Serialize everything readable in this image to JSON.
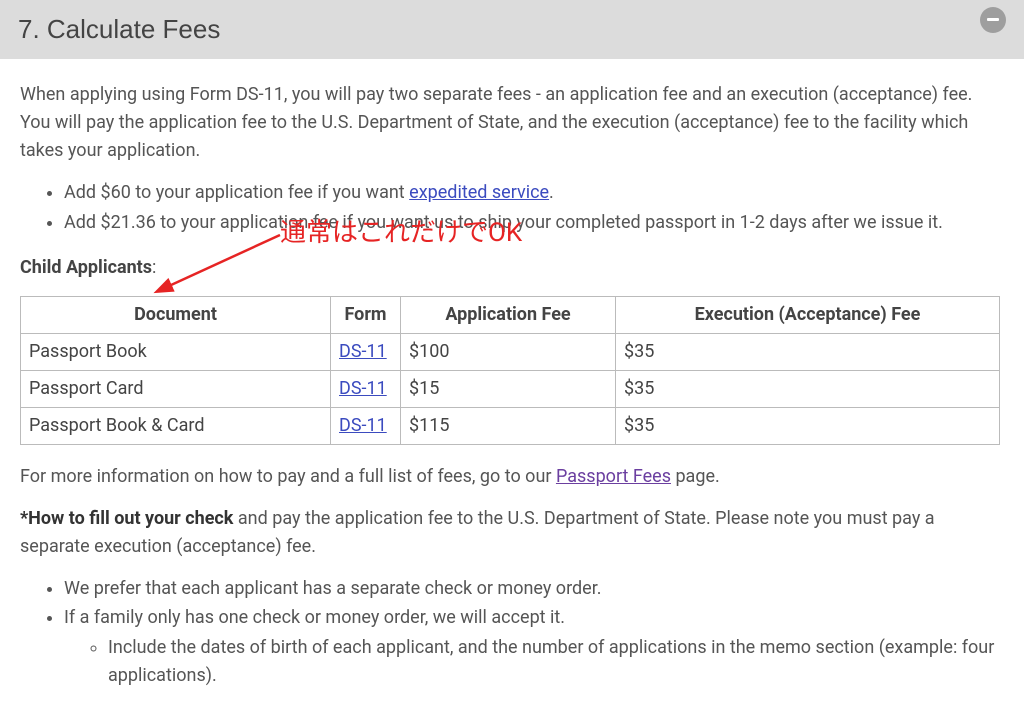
{
  "header": {
    "title": "7. Calculate Fees"
  },
  "intro": "When applying using Form DS-11, you will pay two separate fees - an application fee and an execution (acceptance) fee. You will pay the application fee to the U.S. Department of State, and the execution (acceptance) fee to the facility which takes your application.",
  "bullets_top": {
    "b1_pre": "Add $60 to your application fee if you want ",
    "b1_link": "expedited service",
    "b1_post": ".",
    "b2": "Add $21.36 to your application fee if you want us to ship your completed passport in 1-2 days after we issue it."
  },
  "section_label": {
    "bold": "Child Applicants",
    "rest": ":"
  },
  "annotation_text": "通常はこれだけでOK",
  "table": {
    "headers": [
      "Document",
      "Form",
      "Application Fee",
      "Execution (Acceptance) Fee"
    ],
    "rows": [
      {
        "doc": "Passport Book",
        "form": "DS-11",
        "app_fee": "$100",
        "exec_fee": "$35"
      },
      {
        "doc": "Passport Card",
        "form": "DS-11",
        "app_fee": "$15",
        "exec_fee": "$35"
      },
      {
        "doc": "Passport Book & Card",
        "form": "DS-11",
        "app_fee": "$115",
        "exec_fee": "$35"
      }
    ]
  },
  "more_info": {
    "pre": "For more information on how to pay and a full list of fees, go to our ",
    "link": "Passport Fees",
    "post": " page."
  },
  "check_heading": "*How to fill out your check",
  "check_rest": " and pay the application fee to the U.S. Department of State. Please note you must pay a separate execution (acceptance) fee.",
  "bullets_bottom": {
    "b1": "We prefer that each applicant has a separate check or money order.",
    "b2": "If a family only has one check or money order, we will accept it.",
    "b2a": "Include the dates of birth of each applicant, and the number of applications in the memo section (example: four applications)."
  }
}
